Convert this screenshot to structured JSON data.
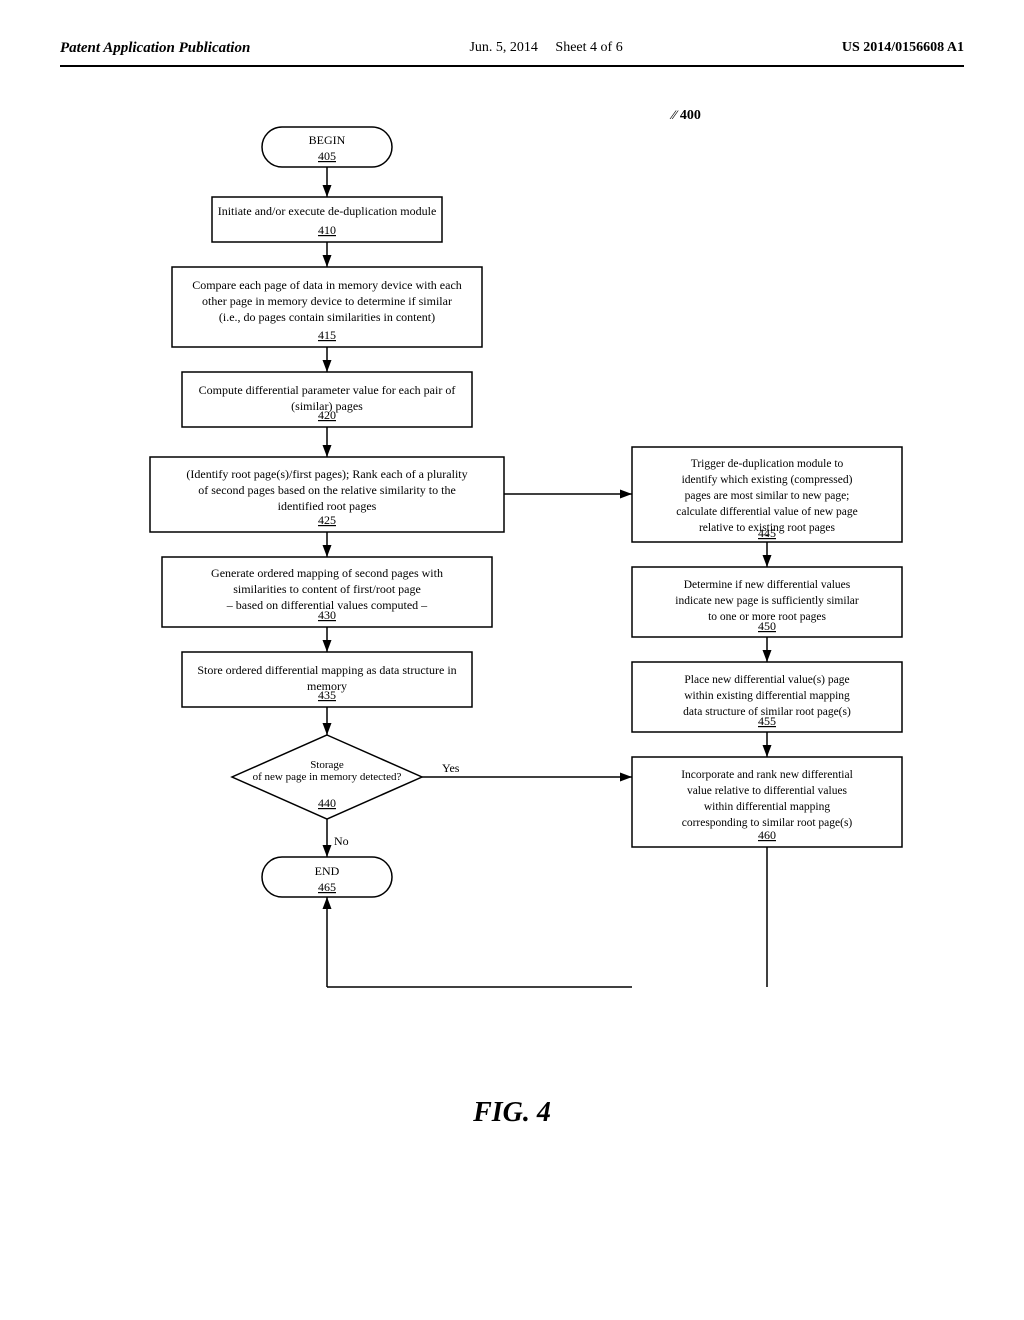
{
  "header": {
    "left": "Patent Application Publication",
    "center_date": "Jun. 5, 2014",
    "center_sheet": "Sheet 4 of 6",
    "right": "US 2014/0156608 A1"
  },
  "diagram_number": "400",
  "figure_label": "FIG. 4",
  "nodes": {
    "begin": {
      "label": "BEGIN",
      "num": "405"
    },
    "n410": {
      "label": "Initiate and/or execute de-duplication module",
      "num": "410"
    },
    "n415": {
      "label": "Compare each page of data in memory device with each other page in memory device to determine if similar (i.e., do pages contain similarities in content)",
      "num": "415"
    },
    "n420": {
      "label": "Compute differential parameter value for each pair of (similar) pages",
      "num": "420"
    },
    "n425": {
      "label": "(Identify root page(s)/first pages); Rank each of a plurality of second pages based on the relative similarity to the identified root pages",
      "num": "425"
    },
    "n430": {
      "label": "Generate ordered mapping of second pages with similarities to content of first/root page – based on differential values computed –",
      "num": "430"
    },
    "n435": {
      "label": "Store ordered differential mapping as data structure in memory",
      "num": "435"
    },
    "n440_label": "Storage of new page in memory detected?",
    "n440_num": "440",
    "end": {
      "label": "END",
      "num": "465"
    },
    "n445": {
      "label": "Trigger de-duplication module to identify which existing (compressed) pages are most similar to new page; calculate differential value of new page relative to existing root pages",
      "num": "445"
    },
    "n450": {
      "label": "Determine if new differential values indicate new page is sufficiently similar to one or more root pages",
      "num": "450"
    },
    "n455": {
      "label": "Place new differential value(s) page within existing differential mapping data structure of similar root page(s)",
      "num": "455"
    },
    "n460": {
      "label": "Incorporate and rank new differential value relative to differential values within differential mapping corresponding to similar root page(s)",
      "num": "460"
    },
    "yes_label": "Yes",
    "no_label": "No"
  }
}
